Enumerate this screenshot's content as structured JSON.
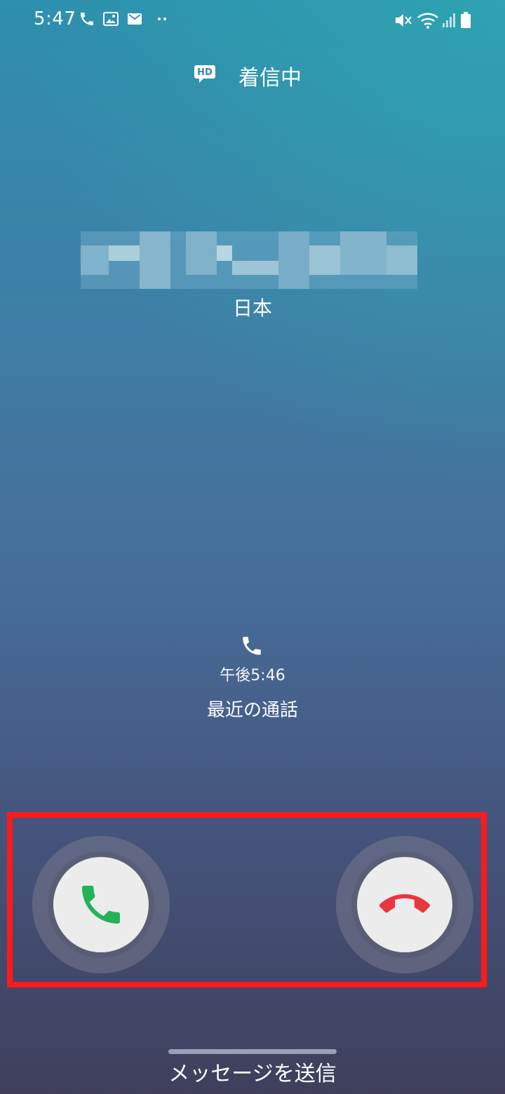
{
  "status_bar": {
    "time": "5:47",
    "left_icons": [
      "phone-icon",
      "image-icon",
      "gmail-icon",
      "more-dots-icon"
    ],
    "right_icons": [
      "mute-icon",
      "wifi-icon",
      "signal-icon",
      "battery-icon"
    ]
  },
  "call": {
    "hd_badge": "HD",
    "status": "着信中",
    "country": "日本"
  },
  "recent": {
    "time": "午後5:46",
    "label": "最近の通話"
  },
  "actions": {
    "accept_icon": "phone-accept-icon",
    "decline_icon": "phone-decline-icon",
    "accept_color": "#22b35a",
    "decline_color": "#e8373e"
  },
  "footer": {
    "send_message": "メッセージを送信"
  },
  "colors": {
    "highlight": "#ff1a1a"
  }
}
